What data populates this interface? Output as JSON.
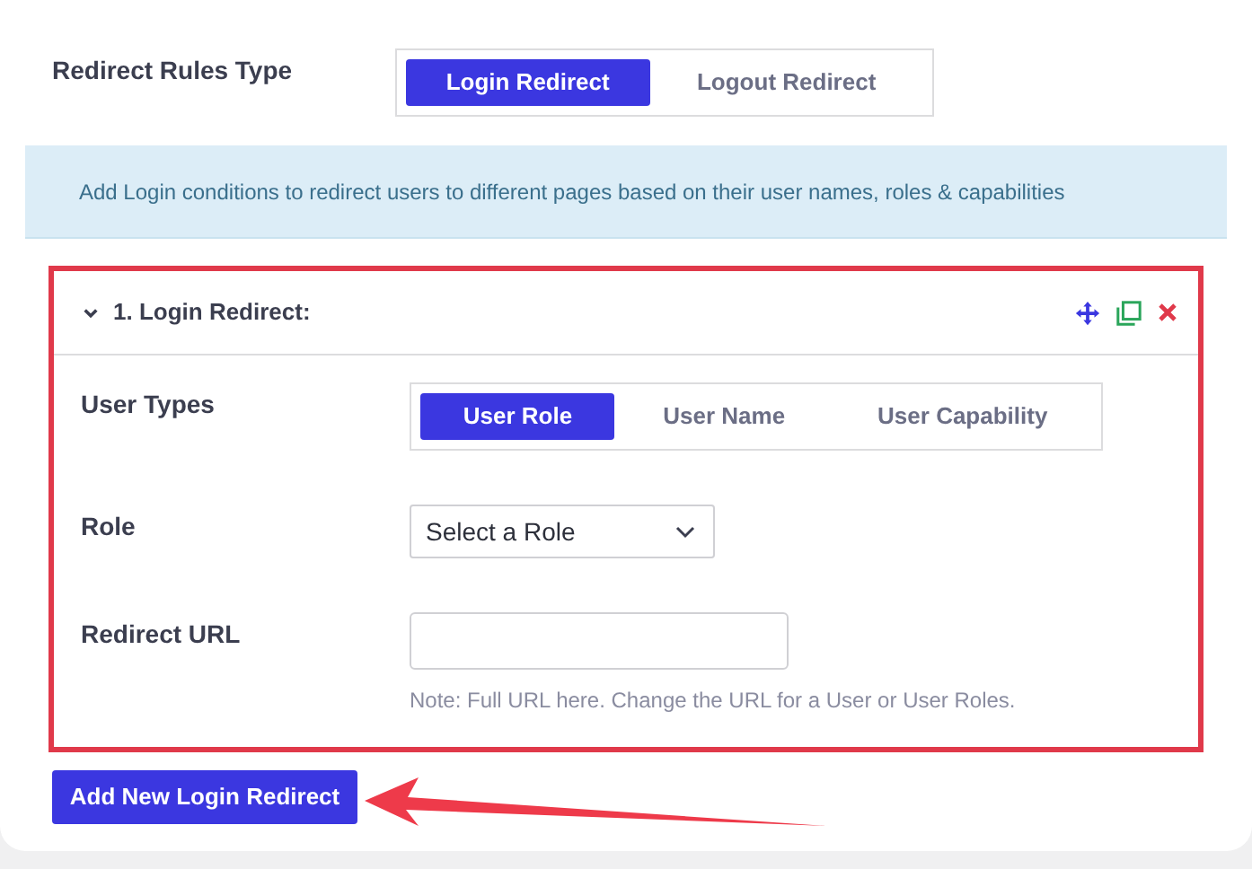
{
  "redirect_rules_type": {
    "label": "Redirect Rules Type",
    "tabs": [
      {
        "label": "Login Redirect",
        "selected": true
      },
      {
        "label": "Logout Redirect",
        "selected": false
      }
    ]
  },
  "info_notice": "Add Login conditions to redirect users to different pages based on their user names, roles & capabilities",
  "rule": {
    "title": "1. Login Redirect:",
    "expanded": true,
    "user_types": {
      "label": "User Types",
      "tabs": [
        {
          "label": "User Role",
          "selected": true
        },
        {
          "label": "User Name",
          "selected": false
        },
        {
          "label": "User Capability",
          "selected": false
        }
      ]
    },
    "role": {
      "label": "Role",
      "value": "Select a Role"
    },
    "redirect_url": {
      "label": "Redirect URL",
      "note": "Note: Full URL here. Change the URL for a User or User Roles."
    }
  },
  "add_button": "Add New Login Redirect"
}
